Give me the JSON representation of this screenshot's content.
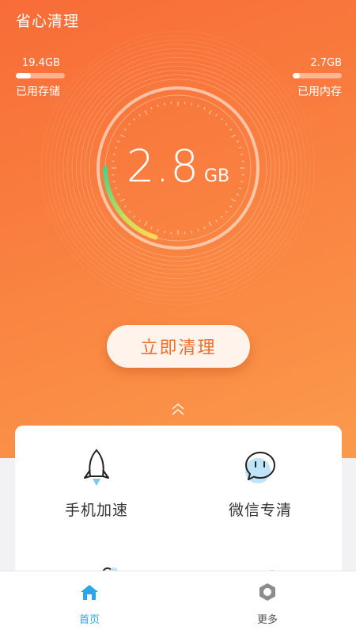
{
  "app": {
    "title": "省心清理"
  },
  "storage": {
    "value": "19.4GB",
    "label": "已用存储",
    "fraction": 0.3
  },
  "memory": {
    "value": "2.7GB",
    "label": "已用内存",
    "fraction": 0.15
  },
  "gauge": {
    "value": "2.8",
    "unit": "GB",
    "arc_fraction": 0.2
  },
  "actions": {
    "clean_label": "立即清理"
  },
  "features": [
    {
      "label": "手机加速",
      "icon": "rocket-icon"
    },
    {
      "label": "微信专清",
      "icon": "chat-bubble-icon"
    }
  ],
  "bottom_nav": [
    {
      "label": "首页",
      "icon": "home-icon",
      "active": true
    },
    {
      "label": "更多",
      "icon": "more-gear-icon",
      "active": false
    }
  ],
  "colors": {
    "primary_orange": "#f8783b",
    "accent_blue": "#2aa7e8",
    "gauge_green": "#63d27c",
    "gauge_yellow": "#ffd65a"
  }
}
